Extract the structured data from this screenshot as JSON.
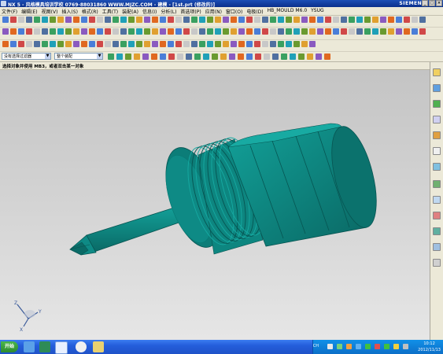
{
  "window": {
    "title": "NX 5 - 风格模具培训学校  0769-88031860  WWW.MJZC.COM - 建模 - [1st.prt (修改的)]",
    "brand": "SIEMENS",
    "min": "_",
    "max": "□",
    "close": "×"
  },
  "menu": [
    "文件(F)",
    "编辑(E)",
    "视图(V)",
    "插入(S)",
    "格式(R)",
    "工具(T)",
    "装配(A)",
    "信息(I)",
    "分析(L)",
    "首选项(P)",
    "应用(N)",
    "窗口(O)",
    "电极(D)",
    "HB_MOULD M6.0",
    "YSUG"
  ],
  "selection": {
    "filter_value": "没有选择过滤器",
    "scope_value": "整个装配"
  },
  "cue_line": "选择对象并使用 MB3，或者双击某一对象",
  "taskbar": {
    "start_label": "开始",
    "lang": "CH",
    "time": "10:12",
    "date": "2012/11/13"
  },
  "colors": {
    "model": "#0e8a85",
    "model_dark": "#0a6a66",
    "model_light": "#14a79f",
    "viewport_top": "#c4c4c4",
    "viewport_bottom": "#e6e6e6",
    "titlebar": "#1c4fb6",
    "taskbar": "#245edb"
  }
}
